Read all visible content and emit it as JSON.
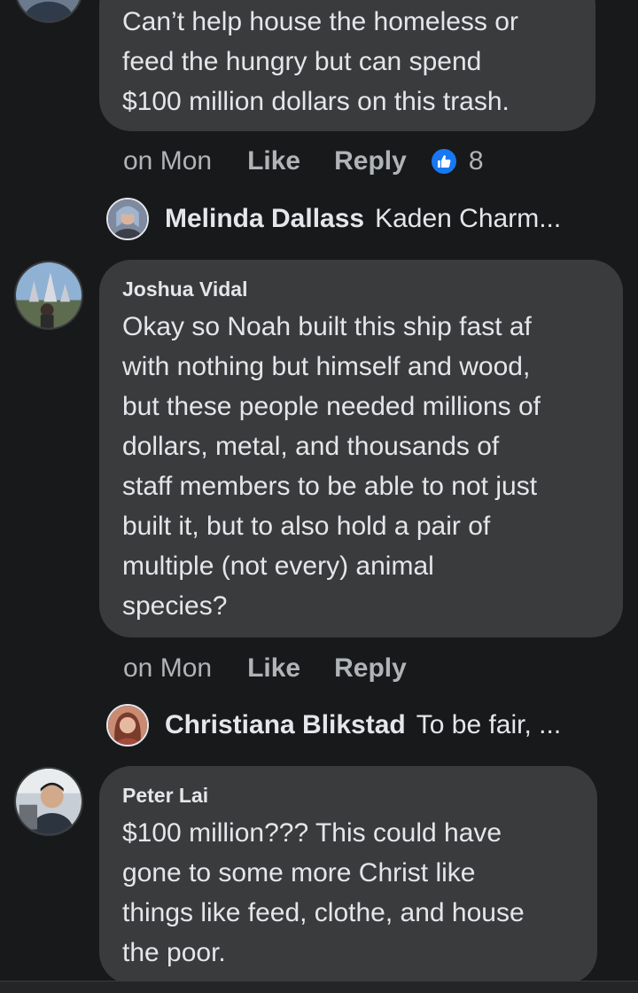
{
  "comments": [
    {
      "text_lines": [
        "Can’t help house the homeless or",
        "feed the hungry but can spend",
        "$100 million dollars on this trash."
      ],
      "time": "on Mon",
      "like_label": "Like",
      "reply_label": "Reply",
      "reaction_count": "8",
      "reply_preview": {
        "name": "Melinda Dallass",
        "snippet": "Kaden Charm..."
      }
    },
    {
      "author": "Joshua Vidal",
      "text_lines": [
        "Okay so Noah built this ship fast af",
        "with nothing but himself and wood,",
        "but these people needed millions of",
        "dollars, metal, and thousands of",
        "staff members to be able to not just",
        "built it, but to also hold a pair of",
        "multiple (not every) animal",
        "species?"
      ],
      "time": "on Mon",
      "like_label": "Like",
      "reply_label": "Reply",
      "reply_preview": {
        "name": "Christiana Blikstad",
        "snippet": "To be fair, ..."
      }
    },
    {
      "author": "Peter Lai",
      "text_lines": [
        "$100 million??? This could have",
        "gone to some more Christ like",
        "things like feed, clothe, and house",
        "the poor."
      ]
    }
  ],
  "icons": {
    "like_reaction": "thumbs-up-icon"
  },
  "colors": {
    "background": "#18191a",
    "bubble": "#3a3b3c",
    "text_primary": "#e4e6eb",
    "text_secondary": "#b0b3b8",
    "like_blue": "#1877f2"
  }
}
